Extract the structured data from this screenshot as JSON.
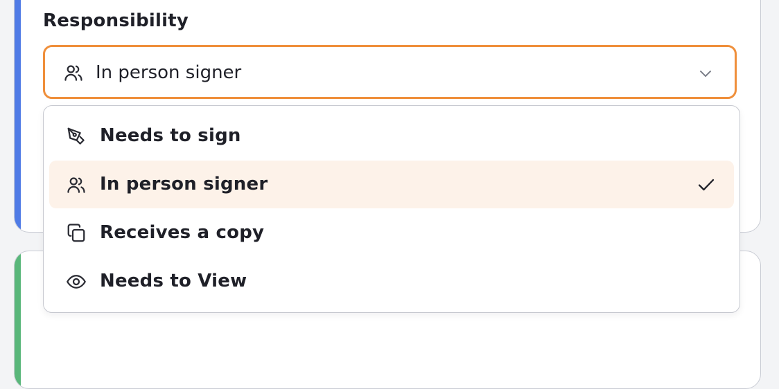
{
  "field": {
    "label": "Responsibility"
  },
  "select": {
    "value": "In person signer",
    "icon": "users-icon",
    "border_color": "#ef8f3b"
  },
  "menu": {
    "options": [
      {
        "label": "Needs to sign",
        "icon": "pen-nib-icon",
        "selected": false
      },
      {
        "label": "In person signer",
        "icon": "users-icon",
        "selected": true
      },
      {
        "label": "Receives a copy",
        "icon": "copy-icon",
        "selected": false
      },
      {
        "label": "Needs to View",
        "icon": "eye-icon",
        "selected": false
      }
    ],
    "selected_bg": "#fdf2e9"
  },
  "cards": {
    "top_accent": "#4f7be6",
    "bottom_accent": "#59b77a"
  }
}
